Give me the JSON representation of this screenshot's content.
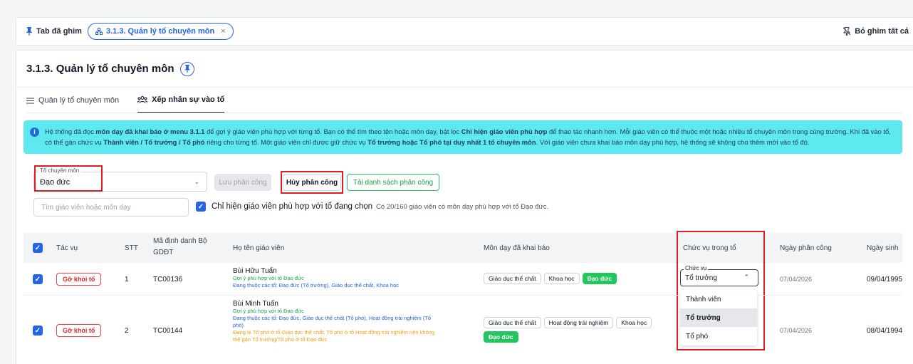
{
  "pinbar": {
    "label": "Tab đã ghim",
    "chip_label": "3.1.3. Quản lý tổ chuyên môn",
    "chip_close": "×",
    "unpin_all": "Bỏ ghim tất cả"
  },
  "header": {
    "title": "3.1.3. Quản lý tổ chuyên môn"
  },
  "tabs": [
    {
      "label": "Quản lý tổ chuyên môn"
    },
    {
      "label": "Xếp nhân sự vào tổ"
    }
  ],
  "info": {
    "p1": "Hệ thống đã đọc ",
    "b1": "môn dạy đã khai báo ở menu 3.1.1",
    "p2": " để gợi ý giáo viên phù hợp với từng tổ. Bạn có thể tìm theo tên hoặc môn dạy, bật lọc ",
    "b2": "Chỉ hiện giáo viên phù hợp",
    "p3": " để thao tác nhanh hơn. Mỗi giáo viên có thể thuộc một hoặc nhiều tổ chuyên môn trong cùng trường. Khi đã vào tổ, có thể gán chức vụ ",
    "b3": "Thành viên / Tổ trưởng / Tổ phó",
    "p4": " riêng cho từng tổ. Một giáo viên chỉ được giữ chức vụ ",
    "b4": "Tổ trưởng hoặc Tổ phó tại duy nhất 1 tổ chuyên môn",
    "p5": ". Với giáo viên chưa khai báo môn dạy phù hợp, hệ thống sẽ không cho thêm mới vào tổ đó."
  },
  "filters": {
    "group_label": "Tổ chuyên môn",
    "group_value": "Đạo đức",
    "save_label": "Lưu phân công",
    "cancel_label": "Hủy phân công",
    "load_label": "Tải danh sách phân công",
    "search_placeholder": "Tìm giáo viên hoặc môn dạy",
    "only_match_label": "Chỉ hiện giáo viên phù hợp với tổ đang chọn",
    "count_text": "Có 20/160 giáo viên có môn dạy phù hợp với tổ Đạo đức."
  },
  "table": {
    "headers": {
      "action": "Tác vụ",
      "stt": "STT",
      "code_1": "Mã định danh Bộ",
      "code_2": "GDĐT",
      "name": "Họ tên giáo viên",
      "subjects": "Môn dạy đã khai báo",
      "role": "Chức vụ trong tổ",
      "assign_date": "Ngày phân công",
      "birth": "Ngày sinh"
    },
    "rows": [
      {
        "action": "Gỡ khỏi tổ",
        "stt": "1",
        "code": "TC00136",
        "name": "Bùi Hữu Tuấn",
        "hint1": "Gợi ý phù hợp với tổ Đạo đức",
        "hint2": "Đang thuộc các tổ: Đạo đức (Tổ trưởng), Giáo dục thể chất, Khoa học",
        "subjects": [
          "Giáo dục thể chất",
          "Khoa học",
          "Đạo đức"
        ],
        "assign_date": "07/04/2026",
        "birth": "09/04/1995"
      },
      {
        "action": "Gỡ khỏi tổ",
        "stt": "2",
        "code": "TC00144",
        "name": "Bùi Minh Tuấn",
        "hint1": "Gợi ý phù hợp với tổ Đạo đức",
        "hint2a": "Đang thuộc các tổ: Đạo đức, Giáo dục thể chất (Tổ phó), Hoạt động trải nghiệm (Tổ",
        "hint2b": "phó)",
        "hint3a": "Đang là Tổ phó ở tổ Giáo dục thể chất, Tổ phó ở tổ Hoạt động trải nghiệm nên không",
        "hint3b": "thể gán Tổ trưởng/Tổ phó ở tổ Đạo đức",
        "subjects": [
          "Giáo dục thể chất",
          "Hoạt động trải nghiệm",
          "Khoa học",
          "Đạo đức"
        ],
        "assign_date": "07/04/2026",
        "birth": "08/04/1994"
      }
    ]
  },
  "role_select": {
    "label": "Chức vụ",
    "value": "Tổ trưởng",
    "options": [
      "Thành viên",
      "Tổ trưởng",
      "Tổ phó"
    ]
  },
  "colors": {
    "accent": "#2563eb",
    "highlight_red": "#e11d24",
    "info_bg": "#5ee8f0",
    "green": "#22c55e"
  }
}
